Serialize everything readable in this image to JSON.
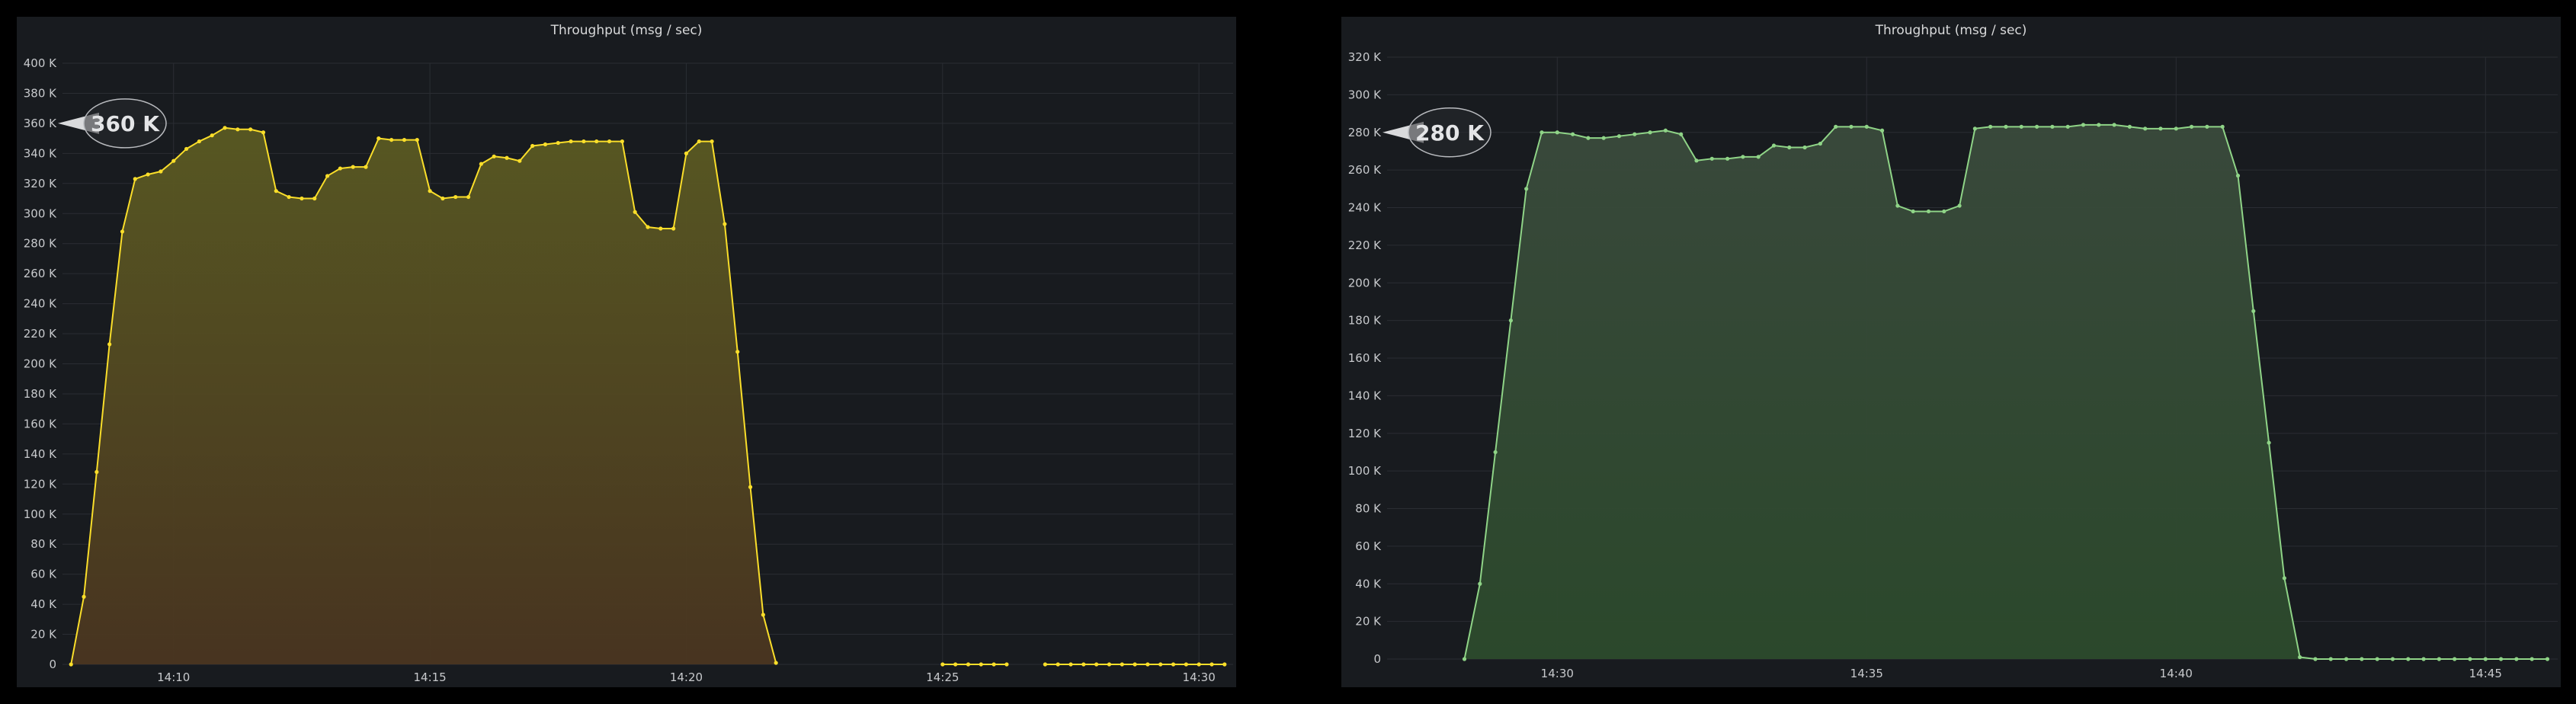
{
  "chart_data": [
    {
      "type": "area",
      "title": "Throughput (msg / sec)",
      "color": "#fade2a",
      "fill_top": "#5a5a22",
      "fill_bottom": "#4a3520",
      "ylim": [
        0,
        400000
      ],
      "y_ticks": [
        {
          "value": 0,
          "label": "0"
        },
        {
          "value": 20000,
          "label": "20 K"
        },
        {
          "value": 40000,
          "label": "40 K"
        },
        {
          "value": 60000,
          "label": "60 K"
        },
        {
          "value": 80000,
          "label": "80 K"
        },
        {
          "value": 100000,
          "label": "100 K"
        },
        {
          "value": 120000,
          "label": "120 K"
        },
        {
          "value": 140000,
          "label": "140 K"
        },
        {
          "value": 160000,
          "label": "160 K"
        },
        {
          "value": 180000,
          "label": "180 K"
        },
        {
          "value": 200000,
          "label": "200 K"
        },
        {
          "value": 220000,
          "label": "220 K"
        },
        {
          "value": 240000,
          "label": "240 K"
        },
        {
          "value": 260000,
          "label": "260 K"
        },
        {
          "value": 280000,
          "label": "280 K"
        },
        {
          "value": 300000,
          "label": "300 K"
        },
        {
          "value": 320000,
          "label": "320 K"
        },
        {
          "value": 340000,
          "label": "340 K"
        },
        {
          "value": 360000,
          "label": "360 K"
        },
        {
          "value": 380000,
          "label": "380 K"
        },
        {
          "value": 400000,
          "label": "400 K"
        }
      ],
      "xlim": [
        "14:07:50",
        "14:30:40"
      ],
      "x_ticks": [
        "14:10",
        "14:15",
        "14:20",
        "14:25",
        "14:30"
      ],
      "callout": {
        "value": 360000,
        "label": "360 K"
      },
      "x": [
        "14:08:00",
        "14:08:15",
        "14:08:30",
        "14:08:45",
        "14:09:00",
        "14:09:15",
        "14:09:30",
        "14:09:45",
        "14:10:00",
        "14:10:15",
        "14:10:30",
        "14:10:45",
        "14:11:00",
        "14:11:15",
        "14:11:30",
        "14:11:45",
        "14:12:00",
        "14:12:15",
        "14:12:30",
        "14:12:45",
        "14:13:00",
        "14:13:15",
        "14:13:30",
        "14:13:45",
        "14:14:00",
        "14:14:15",
        "14:14:30",
        "14:14:45",
        "14:15:00",
        "14:15:15",
        "14:15:30",
        "14:15:45",
        "14:16:00",
        "14:16:15",
        "14:16:30",
        "14:16:45",
        "14:17:00",
        "14:17:15",
        "14:17:30",
        "14:17:45",
        "14:18:00",
        "14:18:15",
        "14:18:30",
        "14:18:45",
        "14:19:00",
        "14:19:15",
        "14:19:30",
        "14:19:45",
        "14:20:00",
        "14:20:15",
        "14:20:30",
        "14:20:45",
        "14:21:00",
        "14:21:15",
        "14:21:30",
        "14:21:45",
        "14:25:00",
        "14:25:15",
        "14:25:30",
        "14:25:45",
        "14:26:00",
        "14:26:15",
        "14:27:00",
        "14:27:15",
        "14:27:30",
        "14:27:45",
        "14:28:00",
        "14:28:15",
        "14:28:30",
        "14:28:45",
        "14:29:00",
        "14:29:15",
        "14:29:30",
        "14:29:45",
        "14:30:00",
        "14:30:15",
        "14:30:30"
      ],
      "y": [
        0,
        45000,
        128000,
        213000,
        288000,
        323000,
        326000,
        328000,
        335000,
        343000,
        348000,
        352000,
        357000,
        356000,
        356000,
        354000,
        315000,
        311000,
        310000,
        310000,
        325000,
        330000,
        331000,
        331000,
        350000,
        349000,
        349000,
        349000,
        315000,
        310000,
        311000,
        311000,
        333000,
        338000,
        337000,
        335000,
        345000,
        346000,
        347000,
        348000,
        348000,
        348000,
        348000,
        348000,
        301000,
        291000,
        290000,
        290000,
        340000,
        348000,
        348000,
        293000,
        208000,
        118000,
        33000,
        1000,
        0,
        0,
        0,
        0,
        0,
        0,
        0,
        0,
        0,
        0,
        0,
        0,
        0,
        0,
        0,
        0,
        0,
        0,
        0,
        0,
        0
      ]
    },
    {
      "type": "area",
      "title": "Throughput (msg / sec)",
      "color": "#8fd487",
      "fill_top": "#3a4a3c",
      "fill_bottom": "#2c4a2c",
      "ylim": [
        0,
        320000
      ],
      "y_ticks": [
        {
          "value": 0,
          "label": "0"
        },
        {
          "value": 20000,
          "label": "20 K"
        },
        {
          "value": 40000,
          "label": "40 K"
        },
        {
          "value": 60000,
          "label": "60 K"
        },
        {
          "value": 80000,
          "label": "80 K"
        },
        {
          "value": 100000,
          "label": "100 K"
        },
        {
          "value": 120000,
          "label": "120 K"
        },
        {
          "value": 140000,
          "label": "140 K"
        },
        {
          "value": 160000,
          "label": "160 K"
        },
        {
          "value": 180000,
          "label": "180 K"
        },
        {
          "value": 200000,
          "label": "200 K"
        },
        {
          "value": 220000,
          "label": "220 K"
        },
        {
          "value": 240000,
          "label": "240 K"
        },
        {
          "value": 260000,
          "label": "260 K"
        },
        {
          "value": 280000,
          "label": "280 K"
        },
        {
          "value": 300000,
          "label": "300 K"
        },
        {
          "value": 320000,
          "label": "320 K"
        }
      ],
      "xlim": [
        "14:27:15",
        "14:46:10"
      ],
      "x_ticks": [
        "14:30",
        "14:35",
        "14:40",
        "14:45"
      ],
      "callout": {
        "value": 280000,
        "label": "280 K"
      },
      "x": [
        "14:28:30",
        "14:28:45",
        "14:29:00",
        "14:29:15",
        "14:29:30",
        "14:29:45",
        "14:30:00",
        "14:30:15",
        "14:30:30",
        "14:30:45",
        "14:31:00",
        "14:31:15",
        "14:31:30",
        "14:31:45",
        "14:32:00",
        "14:32:15",
        "14:32:30",
        "14:32:45",
        "14:33:00",
        "14:33:15",
        "14:33:30",
        "14:33:45",
        "14:34:00",
        "14:34:15",
        "14:34:30",
        "14:34:45",
        "14:35:00",
        "14:35:15",
        "14:35:30",
        "14:35:45",
        "14:36:00",
        "14:36:15",
        "14:36:30",
        "14:36:45",
        "14:37:00",
        "14:37:15",
        "14:37:30",
        "14:37:45",
        "14:38:00",
        "14:38:15",
        "14:38:30",
        "14:38:45",
        "14:39:00",
        "14:39:15",
        "14:39:30",
        "14:39:45",
        "14:40:00",
        "14:40:15",
        "14:40:30",
        "14:40:45",
        "14:41:00",
        "14:41:15",
        "14:41:30",
        "14:41:45",
        "14:42:00",
        "14:42:15",
        "14:42:30",
        "14:42:45",
        "14:43:00",
        "14:43:15",
        "14:43:30",
        "14:43:45",
        "14:44:00",
        "14:44:15",
        "14:44:30",
        "14:44:45",
        "14:45:00",
        "14:45:15",
        "14:45:30",
        "14:45:45",
        "14:46:00"
      ],
      "y": [
        0,
        40000,
        110000,
        180000,
        250000,
        280000,
        280000,
        279000,
        277000,
        277000,
        278000,
        279000,
        280000,
        281000,
        279000,
        265000,
        266000,
        266000,
        267000,
        267000,
        273000,
        272000,
        272000,
        274000,
        283000,
        283000,
        283000,
        281000,
        241000,
        238000,
        238000,
        238000,
        241000,
        282000,
        283000,
        283000,
        283000,
        283000,
        283000,
        283000,
        284000,
        284000,
        284000,
        283000,
        282000,
        282000,
        282000,
        283000,
        283000,
        283000,
        257000,
        185000,
        115000,
        43000,
        1000,
        0,
        0,
        0,
        0,
        0,
        0,
        0,
        0,
        0,
        0,
        0,
        0,
        0,
        0,
        0,
        0
      ]
    }
  ]
}
